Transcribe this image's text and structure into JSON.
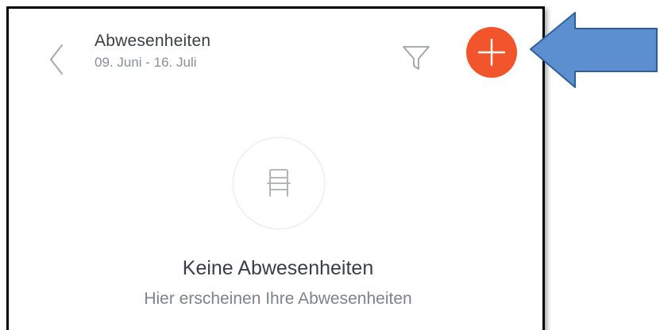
{
  "header": {
    "title": "Abwesenheiten",
    "date_range": "09. Juni - 16. Juli"
  },
  "icons": {
    "back": "chevron-left-icon",
    "filter": "filter-icon",
    "add": "plus-icon",
    "empty_state": "chair-icon",
    "callout": "arrow-left-icon"
  },
  "empty_state": {
    "title": "Keine Abwesenheiten",
    "subtitle": "Hier erscheinen Ihre Abwesenheiten"
  },
  "colors": {
    "accent": "#f2552c",
    "callout_arrow": "#5b8fd0"
  }
}
